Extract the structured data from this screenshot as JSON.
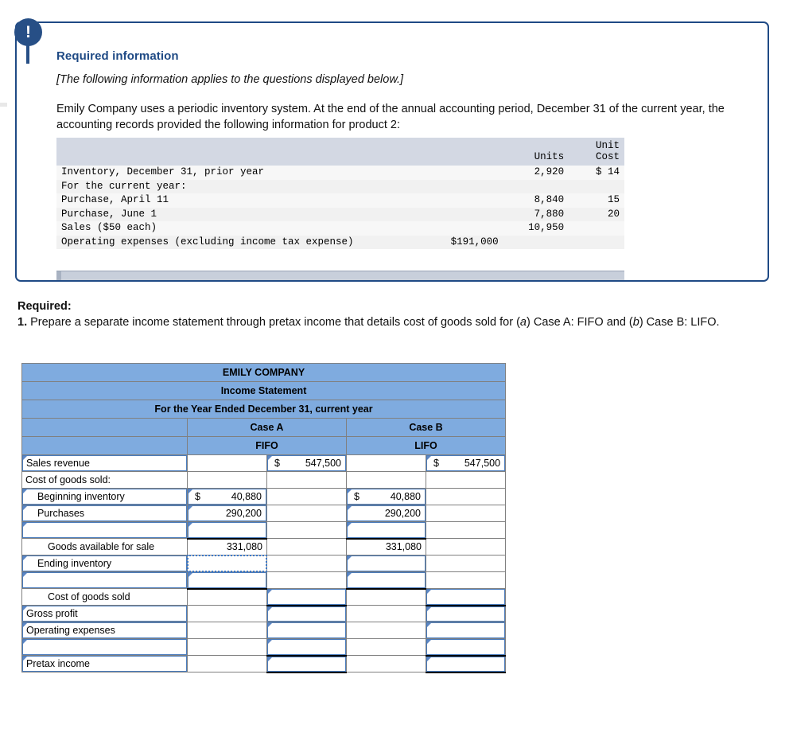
{
  "callout": {
    "icon": "exclamation-icon",
    "heading": "Required information",
    "italic_note": "[The following information applies to the questions displayed below.]",
    "body": "Emily Company uses a periodic inventory system. At the end of the annual accounting period, December 31 of the current year, the accounting records provided the following information for product 2:",
    "info_table": {
      "columns": [
        "",
        "",
        "Units",
        "Unit Cost"
      ],
      "headers": {
        "units": "Units",
        "unit_cost_line1": "Unit",
        "unit_cost_line2": "Cost"
      },
      "rows": [
        {
          "label": "Inventory, December 31, prior year",
          "indent": 0,
          "amount": "",
          "units": "2,920",
          "unit_cost": "$ 14"
        },
        {
          "label": "For the current year:",
          "indent": 0,
          "amount": "",
          "units": "",
          "unit_cost": ""
        },
        {
          "label": "Purchase, April 11",
          "indent": 1,
          "amount": "",
          "units": "8,840",
          "unit_cost": "15"
        },
        {
          "label": "Purchase, June 1",
          "indent": 1,
          "amount": "",
          "units": "7,880",
          "unit_cost": "20"
        },
        {
          "label": "Sales ($50 each)",
          "indent": 1,
          "amount": "",
          "units": "10,950",
          "unit_cost": ""
        },
        {
          "label": "Operating expenses (excluding income tax expense)",
          "indent": 1,
          "amount": "$191,000",
          "units": "",
          "unit_cost": ""
        }
      ]
    }
  },
  "required": {
    "label": "Required:",
    "item_number": "1.",
    "text_part1": " Prepare a separate income statement through pretax income that details cost of goods sold for (",
    "a_marker": "a",
    "text_part2": ") Case A: FIFO and (",
    "b_marker": "b",
    "text_part3": ") Case B: LIFO."
  },
  "worksheet": {
    "title_line1": "EMILY COMPANY",
    "title_line2": "Income Statement",
    "title_line3": "For the Year Ended December 31, current year",
    "case_a": "Case A",
    "case_b": "Case B",
    "method_a": "FIFO",
    "method_b": "LIFO",
    "rows": [
      {
        "label": "Sales revenue",
        "indent": 0,
        "label_editable": true,
        "a_sub": "",
        "a_sub_editable": false,
        "a_total_cur": "$",
        "a_total": "547,500",
        "a_total_editable": true,
        "b_sub": "",
        "b_sub_editable": false,
        "b_total_cur": "$",
        "b_total": "547,500",
        "b_total_editable": true
      },
      {
        "label": "Cost of goods sold:",
        "indent": 0,
        "label_editable": false,
        "a_sub": "",
        "a_sub_editable": false,
        "a_total": "",
        "a_total_editable": false,
        "b_sub": "",
        "b_sub_editable": false,
        "b_total": "",
        "b_total_editable": false
      },
      {
        "label": "Beginning inventory",
        "indent": 1,
        "label_editable": true,
        "a_sub_cur": "$",
        "a_sub": "40,880",
        "a_sub_editable": true,
        "a_total": "",
        "a_total_editable": false,
        "b_sub_cur": "$",
        "b_sub": "40,880",
        "b_sub_editable": true,
        "b_total": "",
        "b_total_editable": false
      },
      {
        "label": "Purchases",
        "indent": 1,
        "label_editable": true,
        "a_sub": "290,200",
        "a_sub_editable": true,
        "a_total": "",
        "a_total_editable": false,
        "b_sub": "290,200",
        "b_sub_editable": true,
        "b_total": "",
        "b_total_editable": false
      },
      {
        "label": "",
        "indent": 1,
        "label_editable": true,
        "a_sub": "",
        "a_sub_editable": true,
        "a_sub_rule_bottom": true,
        "a_total": "",
        "a_total_editable": false,
        "b_sub": "",
        "b_sub_editable": true,
        "b_sub_rule_bottom": true,
        "b_total": "",
        "b_total_editable": false
      },
      {
        "label": "Goods available for sale",
        "indent": 2,
        "label_editable": false,
        "a_sub": "331,080",
        "a_sub_editable": false,
        "a_total": "",
        "a_total_editable": false,
        "b_sub": "331,080",
        "b_sub_editable": false,
        "b_total": "",
        "b_total_editable": false
      },
      {
        "label": "Ending inventory",
        "indent": 1,
        "label_editable": true,
        "a_sub": "",
        "a_sub_editable": true,
        "a_sub_selected": true,
        "a_total": "",
        "a_total_editable": false,
        "b_sub": "",
        "b_sub_editable": true,
        "b_total": "",
        "b_total_editable": false
      },
      {
        "label": "",
        "indent": 0,
        "label_editable": true,
        "a_sub": "",
        "a_sub_editable": true,
        "a_sub_rule_bottom": true,
        "a_total": "",
        "a_total_editable": false,
        "b_sub": "",
        "b_sub_editable": true,
        "b_sub_rule_bottom": true,
        "b_total": "",
        "b_total_editable": false
      },
      {
        "label": "Cost of goods sold",
        "indent": 2,
        "label_editable": false,
        "a_sub": "",
        "a_sub_editable": false,
        "a_total": "",
        "a_total_editable": true,
        "a_total_rule_bottom": true,
        "b_sub": "",
        "b_sub_editable": false,
        "b_total": "",
        "b_total_editable": true,
        "b_total_rule_bottom": true
      },
      {
        "label": "Gross profit",
        "indent": 0,
        "label_editable": true,
        "a_sub": "",
        "a_sub_editable": false,
        "a_total": "",
        "a_total_editable": true,
        "b_sub": "",
        "b_sub_editable": false,
        "b_total": "",
        "b_total_editable": true
      },
      {
        "label": "Operating expenses",
        "indent": 0,
        "label_editable": true,
        "a_sub": "",
        "a_sub_editable": false,
        "a_total": "",
        "a_total_editable": true,
        "b_sub": "",
        "b_sub_editable": false,
        "b_total": "",
        "b_total_editable": true
      },
      {
        "label": "",
        "indent": 0,
        "label_editable": true,
        "a_sub": "",
        "a_sub_editable": false,
        "a_total": "",
        "a_total_editable": true,
        "a_total_rule_bottom": true,
        "b_sub": "",
        "b_sub_editable": false,
        "b_total": "",
        "b_total_editable": true,
        "b_total_rule_bottom": true
      },
      {
        "label": "Pretax income",
        "indent": 0,
        "label_editable": true,
        "a_sub": "",
        "a_sub_editable": false,
        "a_total": "",
        "a_total_editable": true,
        "a_total_rule_bottom": true,
        "b_sub": "",
        "b_sub_editable": false,
        "b_total": "",
        "b_total_editable": true,
        "b_total_rule_bottom": true
      }
    ]
  },
  "colors": {
    "callout_border": "#1f4a85",
    "heading_blue": "#1f4a85",
    "badge_navy": "#274f86",
    "header_blue": "#7fabdf",
    "info_header_gray": "#d3d8e3",
    "cell_border_blue": "#4a7cbd",
    "grid_gray": "#808080",
    "selection_blue": "#3b78c9"
  }
}
